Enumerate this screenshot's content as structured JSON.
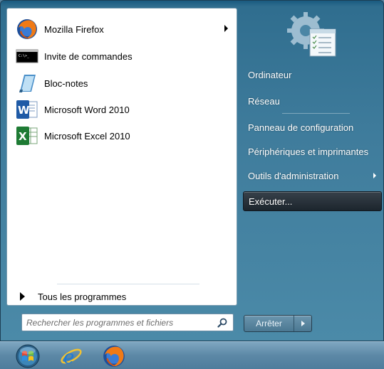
{
  "pinned_programs": [
    {
      "label": "Mozilla Firefox",
      "icon": "firefox-icon",
      "has_submenu": true
    },
    {
      "label": "Invite de commandes",
      "icon": "command-prompt-icon",
      "has_submenu": false
    },
    {
      "label": "Bloc-notes",
      "icon": "notepad-icon",
      "has_submenu": false
    },
    {
      "label": "Microsoft Word 2010",
      "icon": "word-icon",
      "has_submenu": false
    },
    {
      "label": "Microsoft Excel 2010",
      "icon": "excel-icon",
      "has_submenu": false
    }
  ],
  "all_programs_label": "Tous les programmes",
  "search": {
    "placeholder": "Rechercher les programmes et fichiers",
    "value": ""
  },
  "right_panel": {
    "items": [
      {
        "label": "Ordinateur",
        "has_submenu": false,
        "active": false
      },
      {
        "label": "Réseau",
        "has_submenu": false,
        "active": false
      },
      {
        "label": "Panneau de configuration",
        "has_submenu": false,
        "active": false
      },
      {
        "label": "Périphériques et imprimantes",
        "has_submenu": false,
        "active": false
      },
      {
        "label": "Outils d'administration",
        "has_submenu": true,
        "active": false
      },
      {
        "label": "Exécuter...",
        "has_submenu": false,
        "active": true
      }
    ]
  },
  "shutdown": {
    "label": "Arrêter"
  },
  "taskbar": {
    "icons": [
      "start-orb-icon",
      "internet-explorer-icon",
      "firefox-icon"
    ]
  },
  "colors": {
    "panel_accent": "#3f7c9c",
    "highlight": "#1c252d"
  }
}
